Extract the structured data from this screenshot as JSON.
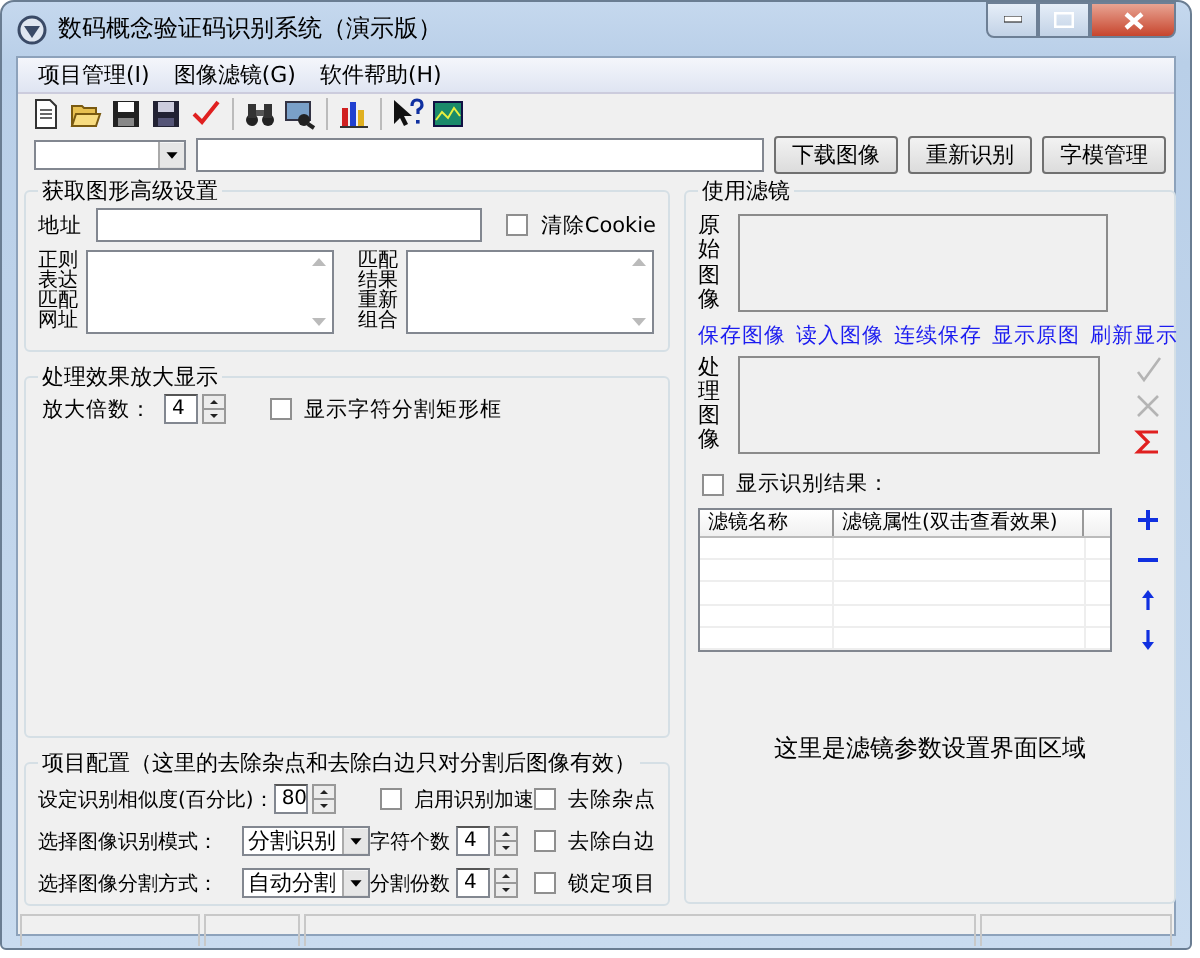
{
  "window": {
    "title": "数码概念验证码识别系统（演示版）"
  },
  "menu": [
    {
      "label": "项目管理(I)"
    },
    {
      "label": "图像滤镜(G)"
    },
    {
      "label": "软件帮助(H)"
    }
  ],
  "url_bar": {
    "buttons": [
      "下载图像",
      "重新识别",
      "字模管理"
    ]
  },
  "advanced": {
    "title": "获取图形高级设置",
    "address_label": "地址",
    "clear_cookie": {
      "label": "清除Cookie",
      "checked": false
    },
    "regex_label": "正则表达匹配网址",
    "regroup_label": "匹配结果重新组合"
  },
  "zoom": {
    "title": "处理效果放大显示",
    "factor_label": "放大倍数：",
    "factor": "4",
    "show_rect": {
      "label": "显示字符分割矩形框",
      "checked": false
    }
  },
  "project": {
    "title": "项目配置（这里的去除杂点和去除白边只对分割后图像有效）",
    "rows": [
      {
        "label": "设定识别相似度(百分比)：",
        "control": {
          "kind": "spin",
          "value": "80"
        },
        "middle": {
          "kind": "check",
          "label": "启用识别加速",
          "checked": false
        },
        "check": {
          "label": "去除杂点",
          "checked": false
        }
      },
      {
        "label": "选择图像识别模式：",
        "control": {
          "kind": "combo",
          "value": "分割识别"
        },
        "middle": {
          "kind": "spin",
          "label": "字符个数",
          "value": "4"
        },
        "check": {
          "label": "去除白边",
          "checked": false
        }
      },
      {
        "label": "选择图像分割方式：",
        "control": {
          "kind": "combo",
          "value": "自动分割"
        },
        "middle": {
          "kind": "spin",
          "label": "分割份数",
          "value": "4"
        },
        "check": {
          "label": "锁定项目",
          "checked": false
        }
      }
    ]
  },
  "filter": {
    "title": "使用滤镜",
    "original_label": "原始图像",
    "links": [
      "保存图像",
      "读入图像",
      "连续保存",
      "显示原图",
      "刷新显示"
    ],
    "processed_label": "处理图像",
    "tools": [
      {
        "kind": "apply",
        "disabled": true
      },
      {
        "kind": "cancel",
        "disabled": true
      },
      {
        "kind": "sum",
        "disabled": false
      }
    ],
    "show_result": {
      "label": "显示识别结果：",
      "checked": false
    },
    "table": {
      "columns": [
        "滤镜名称",
        "滤镜属性(双击查看效果)"
      ]
    },
    "list_tools": [
      {
        "kind": "add"
      },
      {
        "kind": "remove"
      },
      {
        "kind": "up"
      },
      {
        "kind": "down"
      }
    ],
    "note": "这里是滤镜参数设置界面区域"
  }
}
